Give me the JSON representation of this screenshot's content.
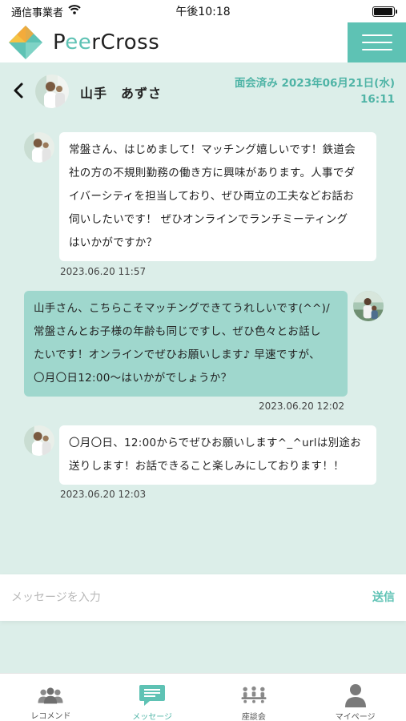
{
  "status_bar": {
    "carrier": "通信事業者",
    "time": "午後10:18",
    "battery_level": 0.95
  },
  "app": {
    "logo_text": [
      "P",
      "ee",
      "r",
      "Cross"
    ],
    "brand_color": "#5ec2b4"
  },
  "conversation": {
    "partner_name": "山手　あずさ",
    "status_line1": "面会済み 2023年06月21日(水)",
    "status_line2": "16:11"
  },
  "messages": [
    {
      "sender": "partner",
      "text_lines": [
        "常盤さん、はじめまして！マッチング嬉しいです！鉄道会",
        "社の方の不規則勤務の働き方に興味があります。人事でダ",
        "イバーシティを担当しており、ぜひ両立の工夫などお話お",
        "伺いしたいです！ ぜひオンラインでランチミーティング",
        "はいかがですか？"
      ],
      "timestamp": "2023.06.20 11:57"
    },
    {
      "sender": "me",
      "text_lines": [
        "山手さん、こちらこそマッチングできてうれしいです(^^)/",
        "常盤さんとお子様の年齢も同じですし、ぜひ色々とお話し",
        "たいです！オンラインでぜひお願いします♪ 早速ですが、",
        "〇月〇日12:00～はいかがでしょうか？"
      ],
      "timestamp": "2023.06.20 12:02"
    },
    {
      "sender": "partner",
      "text_lines": [
        "〇月〇日、12:00からでぜひお願いします^_^urlは別途お",
        "送りします！お話できること楽しみにしております！！"
      ],
      "timestamp": "2023.06.20 12:03"
    }
  ],
  "input": {
    "placeholder": "メッセージを入力",
    "send_label": "送信"
  },
  "tabs": [
    {
      "label": "レコメンド",
      "icon": "people-icon",
      "active": false
    },
    {
      "label": "メッセージ",
      "icon": "chat-icon",
      "active": true
    },
    {
      "label": "座談会",
      "icon": "roundtable-icon",
      "active": false
    },
    {
      "label": "マイページ",
      "icon": "person-icon",
      "active": false
    }
  ]
}
